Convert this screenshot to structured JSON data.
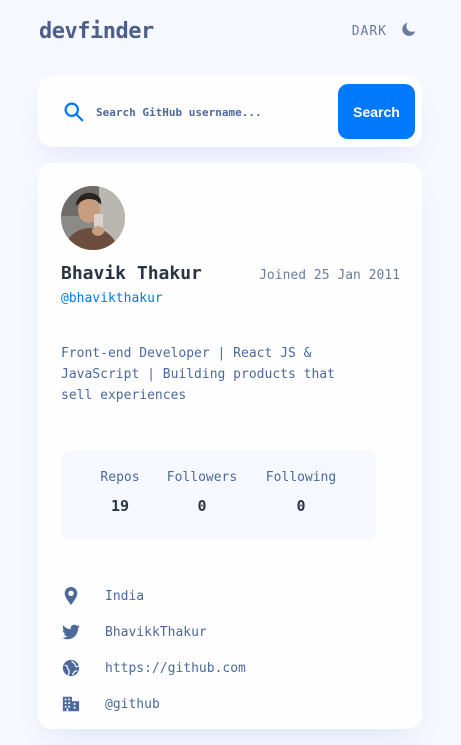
{
  "header": {
    "logo": "devfinder",
    "theme_label": "DARK",
    "theme_icon": "moon-icon"
  },
  "search": {
    "icon": "search-icon",
    "placeholder": "Search GitHub username...",
    "value": "",
    "button_label": "Search"
  },
  "profile": {
    "avatar_icon": "avatar",
    "name": "Bhavik Thakur",
    "joined": "Joined 25 Jan 2011",
    "login": "@bhavikthakur",
    "bio": "Front-end Developer | React JS & JavaScript | Building products that sell experiences"
  },
  "stats": {
    "repos_label": "Repos",
    "repos": "19",
    "followers_label": "Followers",
    "followers": "0",
    "following_label": "Following",
    "following": "0"
  },
  "links": {
    "location": "India",
    "twitter": "BhavikkThakur",
    "website": "https://github.com",
    "company": "@github"
  },
  "colors": {
    "accent": "#0079ff",
    "background": "#f6f8ff",
    "card": "#fefefe",
    "text": "#4b6a9b",
    "heading": "#2b3442"
  }
}
